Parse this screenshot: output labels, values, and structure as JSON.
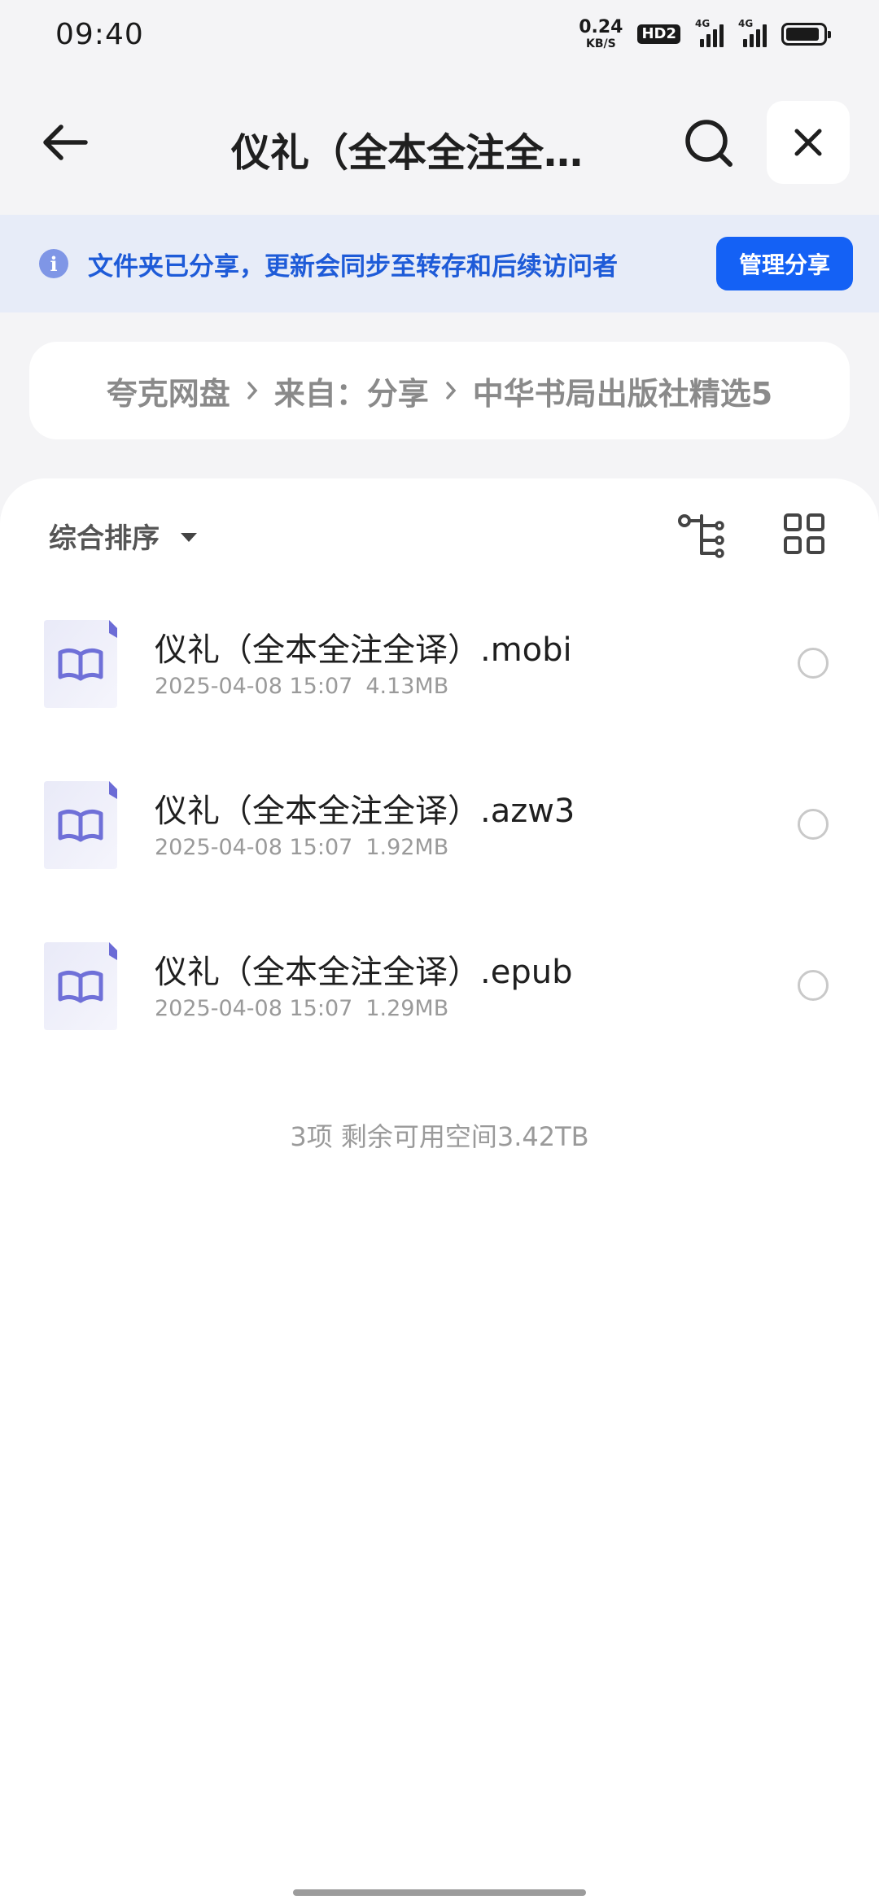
{
  "status_bar": {
    "time": "09:40",
    "net_speed": "0.24",
    "net_unit": "KB/S",
    "hd_label": "HD2",
    "signal1_label": "4G",
    "signal2_label": "4G",
    "battery_level": 0.9
  },
  "header": {
    "title": "仪礼（全本全注全…",
    "back_icon": "arrow-left-icon",
    "search_icon": "search-icon",
    "close_icon": "close-icon"
  },
  "share_banner": {
    "text": "文件夹已分享，更新会同步至转存和后续访问者",
    "button_label": "管理分享",
    "accent_color": "#1461f5"
  },
  "breadcrumb": {
    "items": [
      "夸克网盘",
      "来自：分享",
      "中华书局出版社精选5"
    ]
  },
  "toolbar": {
    "sort_label": "综合排序",
    "tree_icon": "folder-tree-icon",
    "grid_icon": "grid-view-icon"
  },
  "files": [
    {
      "name": "仪礼（全本全注全译）.mobi",
      "date": "2025-04-08 15:07",
      "size": "4.13MB"
    },
    {
      "name": "仪礼（全本全注全译）.azw3",
      "date": "2025-04-08 15:07",
      "size": "1.92MB"
    },
    {
      "name": "仪礼（全本全注全译）.epub",
      "date": "2025-04-08 15:07",
      "size": "1.29MB"
    }
  ],
  "footer": {
    "summary": "3项 剩余可用空间3.42TB"
  }
}
